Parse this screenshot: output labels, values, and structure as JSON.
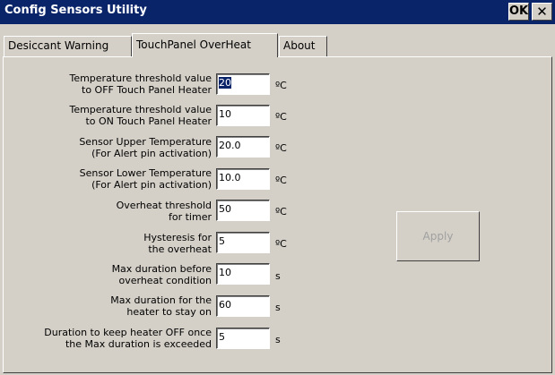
{
  "window": {
    "title": "Config Sensors Utility",
    "ok_label": "OK",
    "close_label": "✕"
  },
  "tabs": [
    {
      "label": "Desiccant Warning"
    },
    {
      "label": "TouchPanel OverHeat"
    },
    {
      "label": "About"
    }
  ],
  "fields": [
    {
      "label1": "Temperature threshold value",
      "label2": "to OFF Touch Panel Heater",
      "value": "20",
      "unit": "ºC"
    },
    {
      "label1": "Temperature threshold value",
      "label2": "to ON Touch Panel Heater",
      "value": "10",
      "unit": "ºC"
    },
    {
      "label1": "Sensor Upper Temperature",
      "label2": "(For Alert pin activation)",
      "value": "20.0",
      "unit": "ºC"
    },
    {
      "label1": "Sensor Lower Temperature",
      "label2": "(For Alert pin activation)",
      "value": "10.0",
      "unit": "ºC"
    },
    {
      "label1": "Overheat threshold",
      "label2": "for timer",
      "value": "50",
      "unit": "ºC"
    },
    {
      "label1": "Hysteresis for",
      "label2": "the overheat",
      "value": "5",
      "unit": "ºC"
    },
    {
      "label1": "Max duration before",
      "label2": "overheat condition",
      "value": "10",
      "unit": "s"
    },
    {
      "label1": "Max duration for the",
      "label2": "heater to stay on",
      "value": "60",
      "unit": "s"
    },
    {
      "label1": "Duration to keep heater OFF once",
      "label2": "the Max duration is exceeded",
      "value": "5",
      "unit": "s"
    }
  ],
  "apply_label": "Apply"
}
